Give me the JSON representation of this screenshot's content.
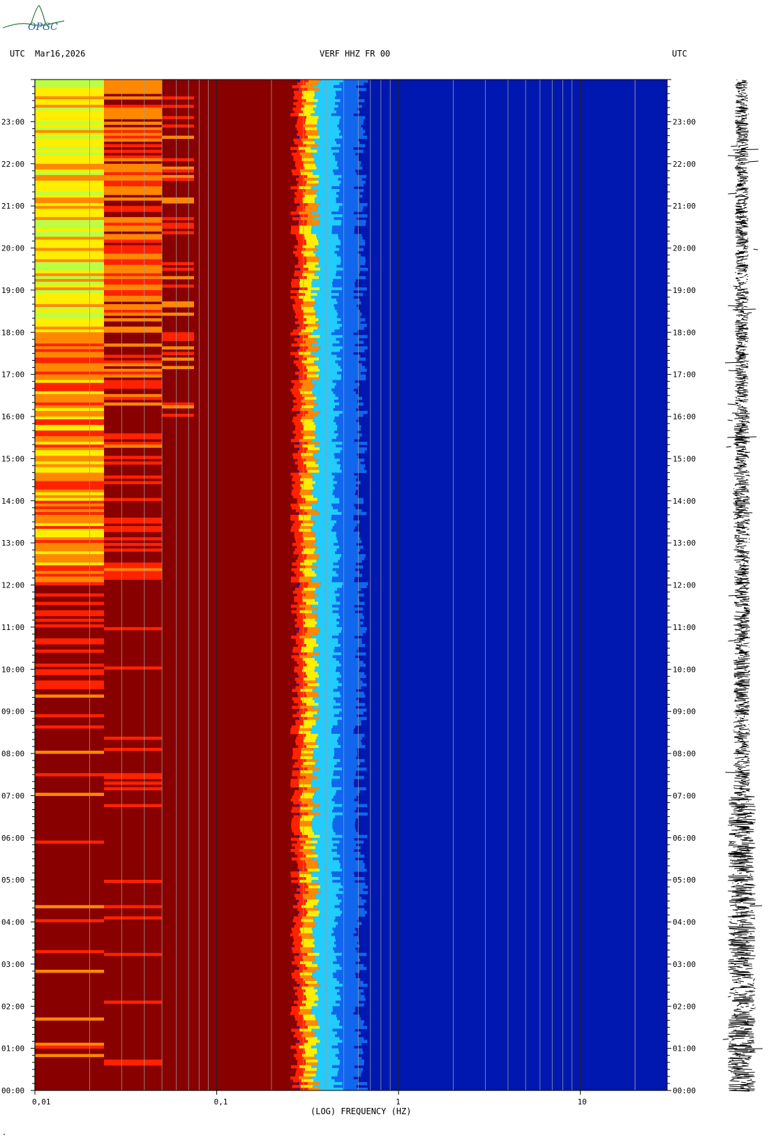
{
  "logo": {
    "text": "OPGC"
  },
  "header": {
    "left": "UTC  Mar16,2026",
    "center": "VERF HHZ FR 00",
    "right": "UTC"
  },
  "footnote": "\"",
  "colors": {
    "low": "#880000",
    "red": "#ff2200",
    "orange": "#ff8800",
    "yellow": "#ffee00",
    "lime": "#bbff44",
    "cyan": "#22ccff",
    "blue": "#0022bb",
    "background_blue": "#0018b0"
  },
  "chart_data": {
    "type": "heatmap",
    "title": "VERF HHZ FR 00",
    "xlabel": "(LOG) FREQUENCY (HZ)",
    "ylabel": "UTC",
    "x_scale": "log",
    "xlim": [
      0.01,
      30
    ],
    "x_ticks": [
      {
        "value": 0.01,
        "label": "0,01"
      },
      {
        "value": 0.1,
        "label": "0,1"
      },
      {
        "value": 1,
        "label": "1"
      },
      {
        "value": 10,
        "label": "10"
      }
    ],
    "ylim_hours": [
      0,
      24
    ],
    "y_ticks": [
      {
        "hour": 0,
        "label": "00:00"
      },
      {
        "hour": 1,
        "label": "01:00"
      },
      {
        "hour": 2,
        "label": "02:00"
      },
      {
        "hour": 3,
        "label": "03:00"
      },
      {
        "hour": 4,
        "label": "04:00"
      },
      {
        "hour": 5,
        "label": "05:00"
      },
      {
        "hour": 6,
        "label": "06:00"
      },
      {
        "hour": 7,
        "label": "07:00"
      },
      {
        "hour": 8,
        "label": "08:00"
      },
      {
        "hour": 9,
        "label": "09:00"
      },
      {
        "hour": 10,
        "label": "10:00"
      },
      {
        "hour": 11,
        "label": "11:00"
      },
      {
        "hour": 12,
        "label": "12:00"
      },
      {
        "hour": 13,
        "label": "13:00"
      },
      {
        "hour": 14,
        "label": "14:00"
      },
      {
        "hour": 15,
        "label": "15:00"
      },
      {
        "hour": 16,
        "label": "16:00"
      },
      {
        "hour": 17,
        "label": "17:00"
      },
      {
        "hour": 18,
        "label": "18:00"
      },
      {
        "hour": 19,
        "label": "19:00"
      },
      {
        "hour": 20,
        "label": "20:00"
      },
      {
        "hour": 21,
        "label": "21:00"
      },
      {
        "hour": 22,
        "label": "22:00"
      },
      {
        "hour": 23,
        "label": "23:00"
      }
    ],
    "frequency_bands": [
      {
        "f_start": 0.01,
        "f_end": 0.024,
        "level": "high at late hours, red-dark mid day"
      },
      {
        "f_start": 0.024,
        "f_end": 0.05,
        "level": "red/orange streaks"
      },
      {
        "f_start": 0.05,
        "f_end": 0.075,
        "level": "sparse red streaks"
      },
      {
        "f_start": 0.075,
        "f_end": 0.28,
        "level": "low (dark red)"
      },
      {
        "f_start": 0.28,
        "f_end": 0.32,
        "level": "red transition"
      },
      {
        "f_start": 0.32,
        "f_end": 0.36,
        "level": "yellow"
      },
      {
        "f_start": 0.36,
        "f_end": 0.5,
        "level": "cyan"
      },
      {
        "f_start": 0.5,
        "f_end": 30,
        "level": "blue"
      }
    ],
    "grid": "vertical lines at decades and sub-decades",
    "seismogram_trace": "right side, time series along the UTC axis"
  }
}
